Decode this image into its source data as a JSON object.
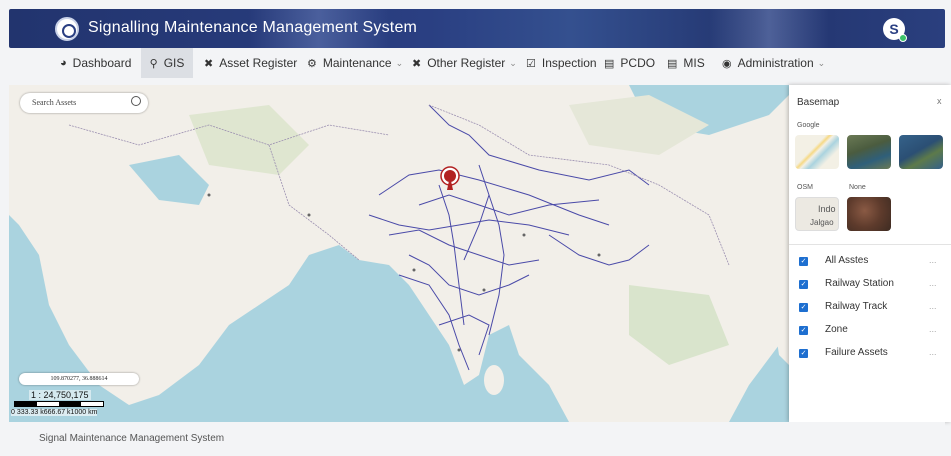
{
  "header": {
    "title": "Signalling Maintenance Management System",
    "avatar_letter": "S",
    "logo_icon": "railway-emblem-icon"
  },
  "nav": [
    {
      "label": "Dashboard",
      "icon": "dashboard-icon"
    },
    {
      "label": "GIS",
      "icon": "map-pin-icon",
      "active": true
    },
    {
      "label": "Asset Register",
      "icon": "tools-icon"
    },
    {
      "label": "Maintenance",
      "icon": "gear-icon",
      "dropdown": true
    },
    {
      "label": "Other Register",
      "icon": "tools-icon",
      "dropdown": true
    },
    {
      "label": "Inspection",
      "icon": "clipboard-check-icon"
    },
    {
      "label": "PCDO",
      "icon": "document-icon"
    },
    {
      "label": "MIS",
      "icon": "report-icon"
    },
    {
      "label": "Administration",
      "icon": "user-circle-icon",
      "dropdown": true
    }
  ],
  "map": {
    "search_placeholder": "Search Assets",
    "coordinates": "109.870277, 36.888614",
    "scale_ratio": "1 : 24,750,175",
    "scale_labels": "0    333.33 k666.67 k1000 km"
  },
  "basemap_panel": {
    "title": "Basemap",
    "close_label": "x",
    "google_label": "Google",
    "osm_label": "OSM",
    "none_label": "None",
    "osm_thumb_text_1": "Indo",
    "osm_thumb_text_2": "Jalgao",
    "layers": [
      {
        "label": "All Asstes",
        "checked": true,
        "more": "..."
      },
      {
        "label": "Railway Station",
        "checked": true,
        "more": "..."
      },
      {
        "label": "Railway Track",
        "checked": true,
        "more": "..."
      },
      {
        "label": "Zone",
        "checked": true,
        "more": "..."
      },
      {
        "label": "Failure Assets",
        "checked": true,
        "more": "..."
      }
    ]
  },
  "footer": {
    "text": "Signal Maintenance Management System"
  },
  "colors": {
    "header_bg": "#2a3f82",
    "checkbox": "#1e6fd0",
    "sea": "#aad3df",
    "land": "#f2efe9",
    "rail_lines": "#4a4aa8",
    "marker": "#b22222"
  }
}
